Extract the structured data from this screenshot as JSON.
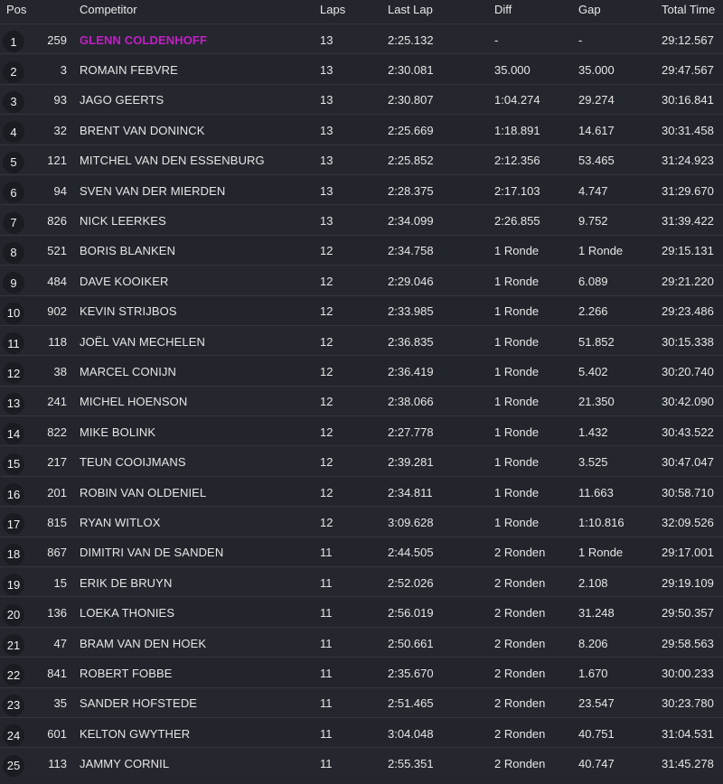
{
  "columns": {
    "pos": "Pos",
    "competitor": "Competitor",
    "laps": "Laps",
    "last_lap": "Last Lap",
    "diff": "Diff",
    "gap": "Gap",
    "total_time": "Total Time"
  },
  "highlight_color": "#c21fc7",
  "rows": [
    {
      "pos": "1",
      "num": "259",
      "name": "GLENN COLDENHOFF",
      "laps": "13",
      "last_lap": "2:25.132",
      "diff": "-",
      "gap": "-",
      "total": "29:12.567"
    },
    {
      "pos": "2",
      "num": "3",
      "name": "ROMAIN FEBVRE",
      "laps": "13",
      "last_lap": "2:30.081",
      "diff": "35.000",
      "gap": "35.000",
      "total": "29:47.567"
    },
    {
      "pos": "3",
      "num": "93",
      "name": "JAGO GEERTS",
      "laps": "13",
      "last_lap": "2:30.807",
      "diff": "1:04.274",
      "gap": "29.274",
      "total": "30:16.841"
    },
    {
      "pos": "4",
      "num": "32",
      "name": "BRENT VAN DONINCK",
      "laps": "13",
      "last_lap": "2:25.669",
      "diff": "1:18.891",
      "gap": "14.617",
      "total": "30:31.458"
    },
    {
      "pos": "5",
      "num": "121",
      "name": "MITCHEL VAN DEN ESSENBURG",
      "laps": "13",
      "last_lap": "2:25.852",
      "diff": "2:12.356",
      "gap": "53.465",
      "total": "31:24.923"
    },
    {
      "pos": "6",
      "num": "94",
      "name": "SVEN VAN DER MIERDEN",
      "laps": "13",
      "last_lap": "2:28.375",
      "diff": "2:17.103",
      "gap": "4.747",
      "total": "31:29.670"
    },
    {
      "pos": "7",
      "num": "826",
      "name": "NICK LEERKES",
      "laps": "13",
      "last_lap": "2:34.099",
      "diff": "2:26.855",
      "gap": "9.752",
      "total": "31:39.422"
    },
    {
      "pos": "8",
      "num": "521",
      "name": "BORIS BLANKEN",
      "laps": "12",
      "last_lap": "2:34.758",
      "diff": "1 Ronde",
      "gap": "1 Ronde",
      "total": "29:15.131"
    },
    {
      "pos": "9",
      "num": "484",
      "name": "DAVE KOOIKER",
      "laps": "12",
      "last_lap": "2:29.046",
      "diff": "1 Ronde",
      "gap": "6.089",
      "total": "29:21.220"
    },
    {
      "pos": "10",
      "num": "902",
      "name": "KEVIN STRIJBOS",
      "laps": "12",
      "last_lap": "2:33.985",
      "diff": "1 Ronde",
      "gap": "2.266",
      "total": "29:23.486"
    },
    {
      "pos": "11",
      "num": "118",
      "name": "JOËL VAN MECHELEN",
      "laps": "12",
      "last_lap": "2:36.835",
      "diff": "1 Ronde",
      "gap": "51.852",
      "total": "30:15.338"
    },
    {
      "pos": "12",
      "num": "38",
      "name": "MARCEL CONIJN",
      "laps": "12",
      "last_lap": "2:36.419",
      "diff": "1 Ronde",
      "gap": "5.402",
      "total": "30:20.740"
    },
    {
      "pos": "13",
      "num": "241",
      "name": "MICHEL HOENSON",
      "laps": "12",
      "last_lap": "2:38.066",
      "diff": "1 Ronde",
      "gap": "21.350",
      "total": "30:42.090"
    },
    {
      "pos": "14",
      "num": "822",
      "name": "MIKE BOLINK",
      "laps": "12",
      "last_lap": "2:27.778",
      "diff": "1 Ronde",
      "gap": "1.432",
      "total": "30:43.522"
    },
    {
      "pos": "15",
      "num": "217",
      "name": "TEUN COOIJMANS",
      "laps": "12",
      "last_lap": "2:39.281",
      "diff": "1 Ronde",
      "gap": "3.525",
      "total": "30:47.047"
    },
    {
      "pos": "16",
      "num": "201",
      "name": "ROBIN VAN OLDENIEL",
      "laps": "12",
      "last_lap": "2:34.811",
      "diff": "1 Ronde",
      "gap": "11.663",
      "total": "30:58.710"
    },
    {
      "pos": "17",
      "num": "815",
      "name": "RYAN WITLOX",
      "laps": "12",
      "last_lap": "3:09.628",
      "diff": "1 Ronde",
      "gap": "1:10.816",
      "total": "32:09.526"
    },
    {
      "pos": "18",
      "num": "867",
      "name": "DIMITRI VAN DE SANDEN",
      "laps": "11",
      "last_lap": "2:44.505",
      "diff": "2 Ronden",
      "gap": "1 Ronde",
      "total": "29:17.001"
    },
    {
      "pos": "19",
      "num": "15",
      "name": "ERIK DE BRUYN",
      "laps": "11",
      "last_lap": "2:52.026",
      "diff": "2 Ronden",
      "gap": "2.108",
      "total": "29:19.109"
    },
    {
      "pos": "20",
      "num": "136",
      "name": "LOEKA THONIES",
      "laps": "11",
      "last_lap": "2:56.019",
      "diff": "2 Ronden",
      "gap": "31.248",
      "total": "29:50.357"
    },
    {
      "pos": "21",
      "num": "47",
      "name": "BRAM VAN DEN HOEK",
      "laps": "11",
      "last_lap": "2:50.661",
      "diff": "2 Ronden",
      "gap": "8.206",
      "total": "29:58.563"
    },
    {
      "pos": "22",
      "num": "841",
      "name": "ROBERT FOBBE",
      "laps": "11",
      "last_lap": "2:35.670",
      "diff": "2 Ronden",
      "gap": "1.670",
      "total": "30:00.233"
    },
    {
      "pos": "23",
      "num": "35",
      "name": "SANDER HOFSTEDE",
      "laps": "11",
      "last_lap": "2:51.465",
      "diff": "2 Ronden",
      "gap": "23.547",
      "total": "30:23.780"
    },
    {
      "pos": "24",
      "num": "601",
      "name": "KELTON GWYTHER",
      "laps": "11",
      "last_lap": "3:04.048",
      "diff": "2 Ronden",
      "gap": "40.751",
      "total": "31:04.531"
    },
    {
      "pos": "25",
      "num": "113",
      "name": "JAMMY CORNIL",
      "laps": "11",
      "last_lap": "2:55.351",
      "diff": "2 Ronden",
      "gap": "40.747",
      "total": "31:45.278"
    }
  ]
}
